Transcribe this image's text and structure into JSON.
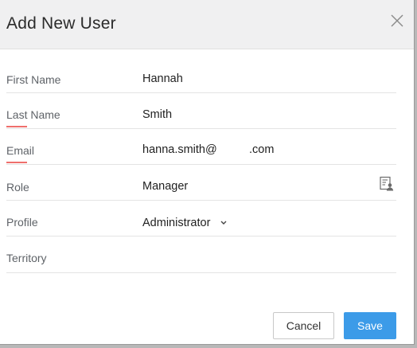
{
  "dialog": {
    "title": "Add New User",
    "close_icon": "close-icon"
  },
  "form": {
    "first_name": {
      "label": "First Name",
      "value": "Hannah",
      "required": false
    },
    "last_name": {
      "label": "Last Name",
      "value": "Smith",
      "required": true
    },
    "email": {
      "label": "Email",
      "value": "hanna.smith@          .com",
      "required": true
    },
    "role": {
      "label": "Role",
      "value": "Manager",
      "icon": "role-lookup-icon"
    },
    "profile": {
      "label": "Profile",
      "value": "Administrator",
      "icon": "chevron-down-icon"
    },
    "territory": {
      "label": "Territory",
      "value": ""
    }
  },
  "buttons": {
    "cancel": "Cancel",
    "save": "Save"
  },
  "colors": {
    "header_bg": "#f0f0f1",
    "required_accent": "#ef6f6c",
    "primary": "#3c9be8"
  }
}
